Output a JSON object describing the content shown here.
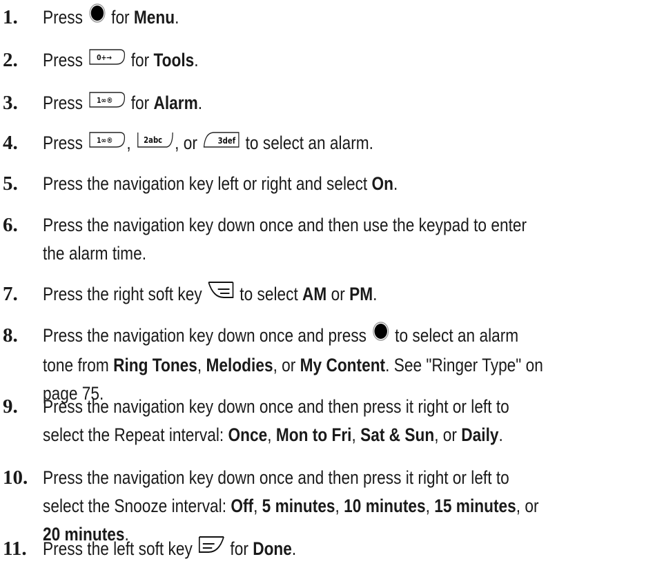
{
  "steps": [
    {
      "num": "1.",
      "parts": [
        [
          "t",
          "Press "
        ],
        [
          "k",
          "center"
        ],
        [
          "t",
          " for "
        ],
        [
          "b",
          "Menu"
        ],
        [
          "t",
          "."
        ]
      ]
    },
    {
      "num": "2.",
      "parts": [
        [
          "t",
          "Press "
        ],
        [
          "k",
          "tools"
        ],
        [
          "t",
          " for "
        ],
        [
          "b",
          "Tools"
        ],
        [
          "t",
          "."
        ]
      ]
    },
    {
      "num": "3.",
      "parts": [
        [
          "t",
          "Press "
        ],
        [
          "k",
          "k1"
        ],
        [
          "t",
          " for "
        ],
        [
          "b",
          "Alarm"
        ],
        [
          "t",
          "."
        ]
      ]
    },
    {
      "num": "4.",
      "parts": [
        [
          "t",
          "Press "
        ],
        [
          "k",
          "k1"
        ],
        [
          "t",
          ", "
        ],
        [
          "k",
          "k2"
        ],
        [
          "t",
          ", or "
        ],
        [
          "k",
          "k3"
        ],
        [
          "t",
          " to select an alarm."
        ]
      ]
    },
    {
      "num": "5.",
      "parts": [
        [
          "t",
          "Press the navigation key left or right and select "
        ],
        [
          "b",
          "On"
        ],
        [
          "t",
          "."
        ]
      ]
    },
    {
      "num": "6.",
      "parts": [
        [
          "t",
          "Press the navigation key down once and then use the keypad to enter"
        ],
        [
          "br",
          ""
        ],
        [
          "t",
          "the alarm time."
        ]
      ]
    },
    {
      "num": "7.",
      "parts": [
        [
          "t",
          "Press the right soft key "
        ],
        [
          "k",
          "rsoft"
        ],
        [
          "t",
          " to select "
        ],
        [
          "b",
          "AM"
        ],
        [
          "t",
          " or "
        ],
        [
          "b",
          "PM"
        ],
        [
          "t",
          "."
        ]
      ]
    },
    {
      "num": "8.",
      "parts": [
        [
          "t",
          "Press the navigation key down once and press "
        ],
        [
          "k",
          "center"
        ],
        [
          "t",
          " to select an alarm"
        ],
        [
          "br",
          ""
        ],
        [
          "t",
          "tone from "
        ],
        [
          "b",
          "Ring Tones"
        ],
        [
          "t",
          ", "
        ],
        [
          "b",
          "Melodies"
        ],
        [
          "t",
          ", or "
        ],
        [
          "b",
          "My Content"
        ],
        [
          "t",
          ". See \"Ringer Type\" on"
        ],
        [
          "br",
          ""
        ],
        [
          "t",
          "page 75."
        ]
      ]
    },
    {
      "num": "9.",
      "parts": [
        [
          "t",
          "Press the navigation key down once and then press it right or left to"
        ],
        [
          "br",
          ""
        ],
        [
          "t",
          "select the Repeat interval: "
        ],
        [
          "b",
          "Once"
        ],
        [
          "t",
          ", "
        ],
        [
          "b",
          "Mon to Fri"
        ],
        [
          "t",
          ", "
        ],
        [
          "b",
          "Sat & Sun"
        ],
        [
          "t",
          ", or "
        ],
        [
          "b",
          "Daily"
        ],
        [
          "t",
          "."
        ]
      ]
    },
    {
      "num": "10.",
      "parts": [
        [
          "t",
          "Press the navigation key down once and then press it right or left to"
        ],
        [
          "br",
          ""
        ],
        [
          "t",
          "select the Snooze interval: "
        ],
        [
          "b",
          "Off"
        ],
        [
          "t",
          ", "
        ],
        [
          "b",
          "5 minutes"
        ],
        [
          "t",
          ", "
        ],
        [
          "b",
          "10 minutes"
        ],
        [
          "t",
          ", "
        ],
        [
          "b",
          "15 minutes"
        ],
        [
          "t",
          ", or"
        ],
        [
          "br",
          ""
        ],
        [
          "b",
          "20 minutes"
        ],
        [
          "t",
          "."
        ]
      ]
    },
    {
      "num": "11.",
      "parts": [
        [
          "t",
          "Press the left soft key "
        ],
        [
          "k",
          "lsoft"
        ],
        [
          "t",
          " for "
        ],
        [
          "b",
          "Done"
        ],
        [
          "t",
          "."
        ]
      ]
    }
  ],
  "key_icons": {
    "center": "center-key-icon",
    "tools": "tools-key-icon",
    "k1": "key-1-icon",
    "k2": "key-2-abc-icon",
    "k3": "key-3-def-icon",
    "rsoft": "right-soft-key-icon",
    "lsoft": "left-soft-key-icon"
  },
  "key_glyphs": {
    "tools": "0+→",
    "k1": "1∞®",
    "k2": "2abc",
    "k3": "3def"
  }
}
